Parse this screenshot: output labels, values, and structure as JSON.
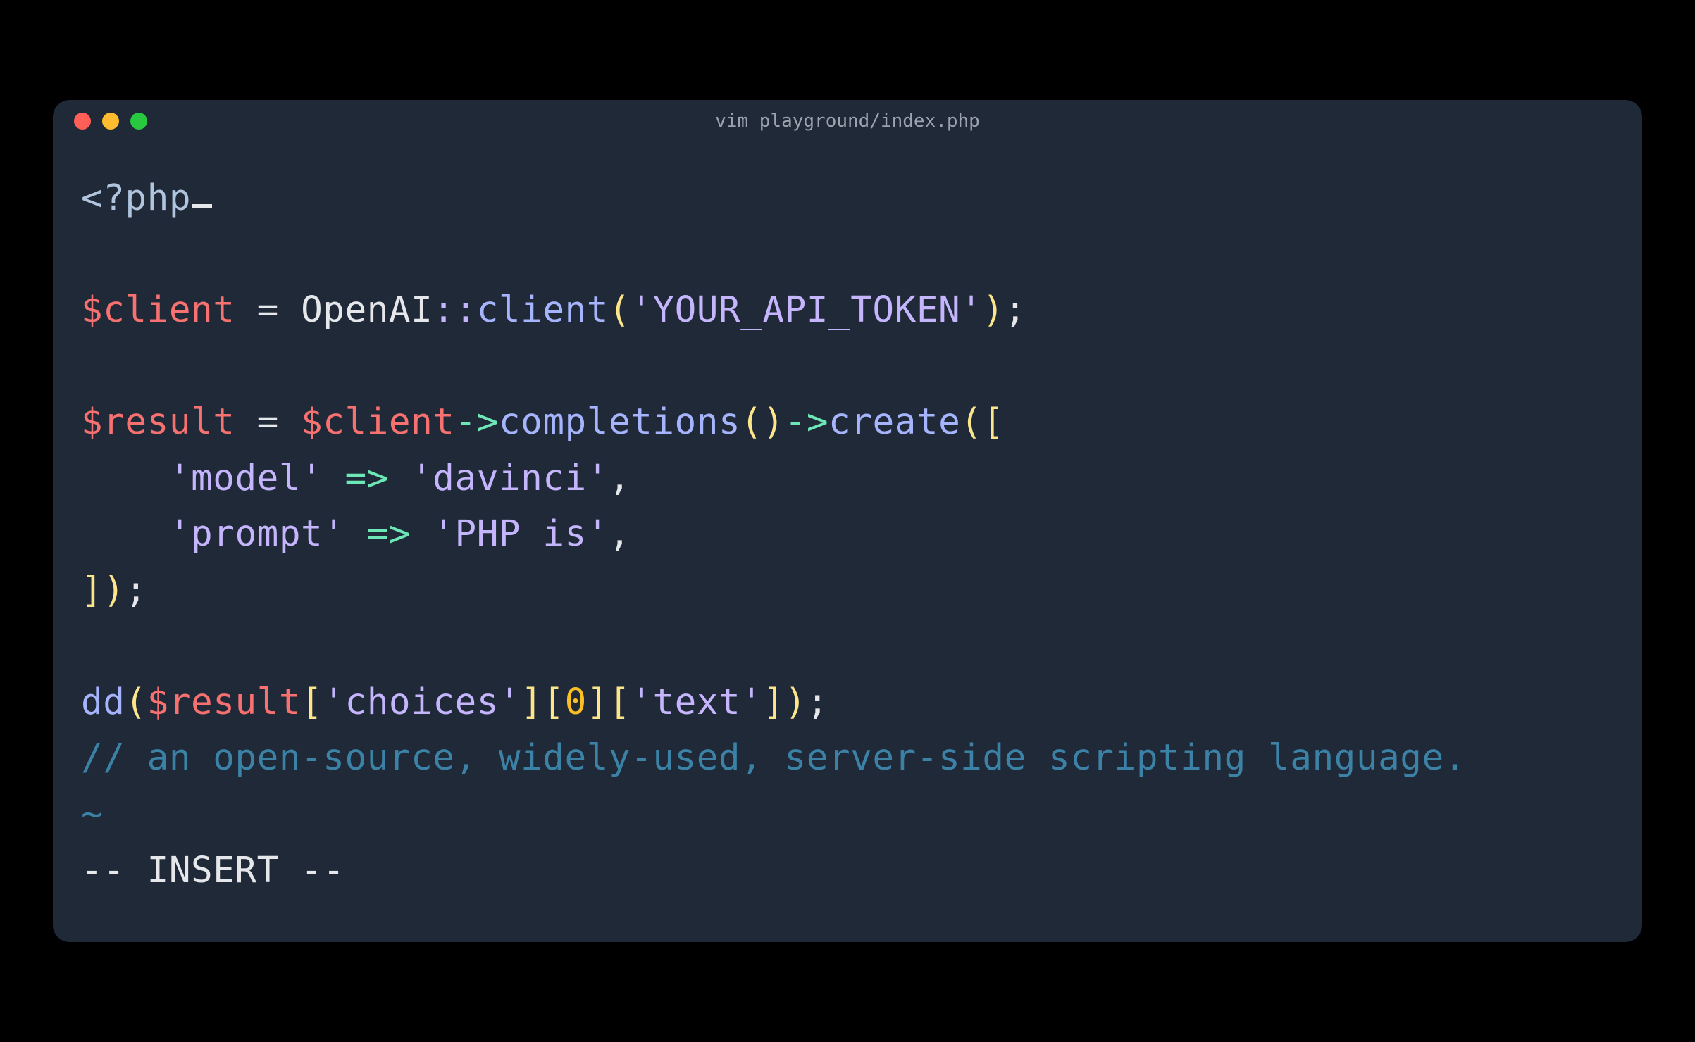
{
  "window": {
    "title": "vim playground/index.php"
  },
  "code": {
    "l1_php_open": "<?php",
    "l3_var_client": "$client",
    "l3_assign": " = ",
    "l3_openai": "OpenAI",
    "l3_scope": "::",
    "l3_client_method": "client",
    "l3_open_paren": "(",
    "l3_token": "'YOUR_API_TOKEN'",
    "l3_close_paren": ")",
    "l3_semi": ";",
    "l5_var_result": "$result",
    "l5_assign": " = ",
    "l5_var_client": "$client",
    "l5_arrow1": "->",
    "l5_completions": "completions",
    "l5_paren_open": "(",
    "l5_paren_close": ")",
    "l5_arrow2": "->",
    "l5_create": "create",
    "l5_create_open": "(",
    "l5_bracket_open": "[",
    "l6_indent": "    ",
    "l6_key_model": "'model'",
    "l6_arrow": " => ",
    "l6_val_davinci": "'davinci'",
    "l6_comma": ",",
    "l7_indent": "    ",
    "l7_key_prompt": "'prompt'",
    "l7_arrow": " => ",
    "l7_val_phpis": "'PHP is'",
    "l7_comma": ",",
    "l8_bracket_close": "]",
    "l8_paren_close": ")",
    "l8_semi": ";",
    "l10_dd": "dd",
    "l10_paren_open": "(",
    "l10_var_result": "$result",
    "l10_br1_open": "[",
    "l10_choices": "'choices'",
    "l10_br1_close": "]",
    "l10_br2_open": "[",
    "l10_zero": "0",
    "l10_br2_close": "]",
    "l10_br3_open": "[",
    "l10_text": "'text'",
    "l10_br3_close": "]",
    "l10_paren_close": ")",
    "l10_semi": ";",
    "l11_comment": "// an open-source, widely-used, server-side scripting language.",
    "l12_tilde": "~"
  },
  "mode": {
    "text": "-- INSERT --"
  }
}
